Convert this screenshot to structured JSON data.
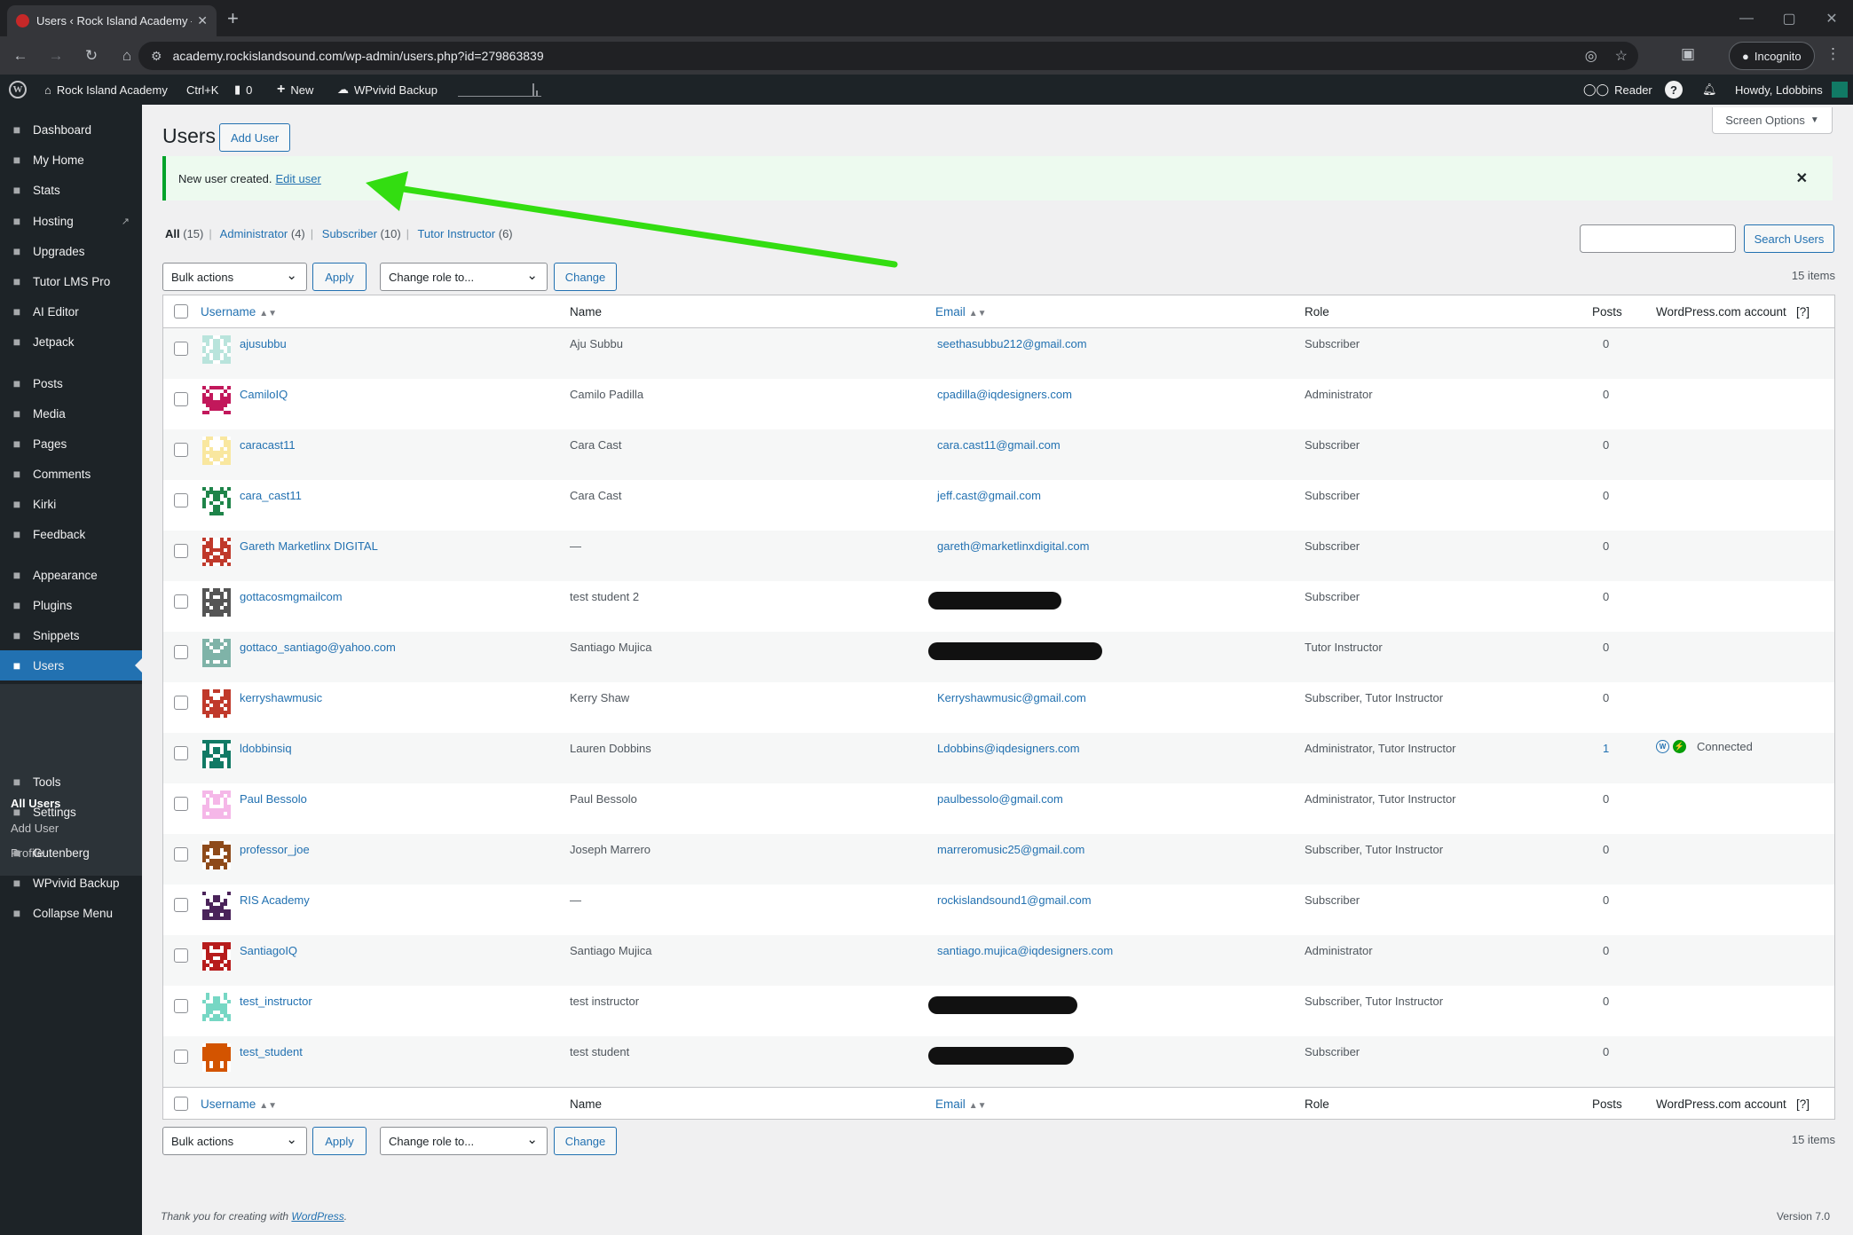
{
  "browser": {
    "tab_title": "Users ‹ Rock Island Academy —",
    "url": "academy.rockislandsound.com/wp-admin/users.php?id=279863839",
    "incognito_label": "Incognito"
  },
  "adminbar": {
    "site_name": "Rock Island Academy",
    "shortcut": "Ctrl+K",
    "comments_count": "0",
    "new_label": "New",
    "backup_label": "WPvivid Backup",
    "reader_label": "Reader",
    "howdy": "Howdy, Ldobbins"
  },
  "sidebar": {
    "items": [
      {
        "label": "Dashboard",
        "icon": "dashboard-icon"
      },
      {
        "label": "My Home",
        "icon": "home-icon"
      },
      {
        "label": "Stats",
        "icon": "stats-icon"
      },
      {
        "label": "Hosting",
        "icon": "cloud-icon"
      },
      {
        "label": "Upgrades",
        "icon": "cart-icon"
      },
      {
        "label": "Tutor LMS Pro",
        "icon": "tutor-icon"
      },
      {
        "label": "AI Editor",
        "icon": "sparkle-icon"
      },
      {
        "label": "Jetpack",
        "icon": "jetpack-icon"
      },
      {
        "label": "Posts",
        "icon": "pin-icon"
      },
      {
        "label": "Media",
        "icon": "media-icon"
      },
      {
        "label": "Pages",
        "icon": "page-icon"
      },
      {
        "label": "Comments",
        "icon": "comment-icon"
      },
      {
        "label": "Kirki",
        "icon": "kirki-icon"
      },
      {
        "label": "Feedback",
        "icon": "feedback-icon"
      },
      {
        "label": "Appearance",
        "icon": "brush-icon"
      },
      {
        "label": "Plugins",
        "icon": "plug-icon"
      },
      {
        "label": "Snippets",
        "icon": "snippets-icon"
      },
      {
        "label": "Users",
        "icon": "users-icon"
      },
      {
        "label": "Tools",
        "icon": "wrench-icon"
      },
      {
        "label": "Settings",
        "icon": "settings-icon"
      },
      {
        "label": "Gutenberg",
        "icon": "gutenberg-icon"
      },
      {
        "label": "WPvivid Backup",
        "icon": "cloud-icon"
      },
      {
        "label": "Collapse Menu",
        "icon": "collapse-icon"
      }
    ],
    "submenu": [
      "All Users",
      "Add User",
      "Profile"
    ]
  },
  "page": {
    "screen_options": "Screen Options",
    "title": "Users",
    "add_user": "Add User",
    "notice_text": "New user created.",
    "notice_link": "Edit user",
    "filters": {
      "all": "All",
      "all_count": "(15)",
      "admin": "Administrator",
      "admin_count": "(4)",
      "sub": "Subscriber",
      "sub_count": "(10)",
      "tutor": "Tutor Instructor",
      "tutor_count": "(6)"
    },
    "search_button": "Search Users",
    "bulk_actions": "Bulk actions",
    "apply": "Apply",
    "change_role": "Change role to...",
    "change": "Change",
    "items_count": "15 items"
  },
  "table": {
    "columns": [
      "Username",
      "Name",
      "Email",
      "Role",
      "Posts",
      "WordPress.com account",
      "[?]"
    ],
    "rows": [
      {
        "username": "ajusubbu",
        "name": "Aju Subbu",
        "email": "seethasubbu212@gmail.com",
        "role": "Subscriber",
        "posts": "0",
        "account": "",
        "color": "#b9e4dc"
      },
      {
        "username": "CamiloIQ",
        "name": "Camilo Padilla",
        "email": "cpadilla@iqdesigners.com",
        "role": "Administrator",
        "posts": "0",
        "account": "",
        "color": "#c2185b"
      },
      {
        "username": "caracast11",
        "name": "Cara Cast",
        "email": "cara.cast11@gmail.com",
        "role": "Subscriber",
        "posts": "0",
        "account": "",
        "color": "#f9e79f"
      },
      {
        "username": "cara_cast11",
        "name": "Cara Cast",
        "email": "jeff.cast@gmail.com",
        "role": "Subscriber",
        "posts": "0",
        "account": "",
        "color": "#1e8449"
      },
      {
        "username": "Gareth Marketlinx DIGITAL",
        "name": "—",
        "email": "gareth@marketlinxdigital.com",
        "role": "Subscriber",
        "posts": "0",
        "account": "",
        "color": "#c0392b"
      },
      {
        "username": "gottacosmgmailcom",
        "name": "test student 2",
        "email": "",
        "role": "Subscriber",
        "posts": "0",
        "account": "",
        "color": "#555555"
      },
      {
        "username": "gottaco_santiago@yahoo.com",
        "name": "Santiago Mujica",
        "email": "",
        "role": "Tutor Instructor",
        "posts": "0",
        "account": "",
        "color": "#7fb3a8"
      },
      {
        "username": "kerryshawmusic",
        "name": "Kerry Shaw",
        "email": "Kerryshawmusic@gmail.com",
        "role": "Subscriber, Tutor Instructor",
        "posts": "0",
        "account": "",
        "color": "#c0392b"
      },
      {
        "username": "ldobbinsiq",
        "name": "Lauren Dobbins",
        "email": "Ldobbins@iqdesigners.com",
        "role": "Administrator, Tutor Instructor",
        "posts": "1",
        "account": "Connected",
        "color": "#117a65"
      },
      {
        "username": "Paul Bessolo",
        "name": "Paul Bessolo",
        "email": "paulbessolo@gmail.com",
        "role": "Administrator, Tutor Instructor",
        "posts": "0",
        "account": "",
        "color": "#f5b7e8"
      },
      {
        "username": "professor_joe",
        "name": "Joseph Marrero",
        "email": "marreromusic25@gmail.com",
        "role": "Subscriber, Tutor Instructor",
        "posts": "0",
        "account": "",
        "color": "#8e4a1a"
      },
      {
        "username": "RIS Academy",
        "name": "—",
        "email": "rockislandsound1@gmail.com",
        "role": "Subscriber",
        "posts": "0",
        "account": "",
        "color": "#4a235a"
      },
      {
        "username": "SantiagoIQ",
        "name": "Santiago Mujica",
        "email": "santiago.mujica@iqdesigners.com",
        "role": "Administrator",
        "posts": "0",
        "account": "",
        "color": "#b71c1c"
      },
      {
        "username": "test_instructor",
        "name": "test instructor",
        "email": "",
        "role": "Subscriber, Tutor Instructor",
        "posts": "0",
        "account": "",
        "color": "#76d7c4"
      },
      {
        "username": "test_student",
        "name": "test student",
        "email": "",
        "role": "Subscriber",
        "posts": "0",
        "account": "",
        "color": "#d35400"
      }
    ]
  },
  "footer": {
    "thanks": "Thank you for creating with",
    "wp_link": "WordPress",
    "version": "Version 7.0"
  },
  "colors": {
    "accent": "#2271b1",
    "success": "#00a32a",
    "annotation_arrow": "#33dd11",
    "sidebar_bg": "#1d2327"
  }
}
